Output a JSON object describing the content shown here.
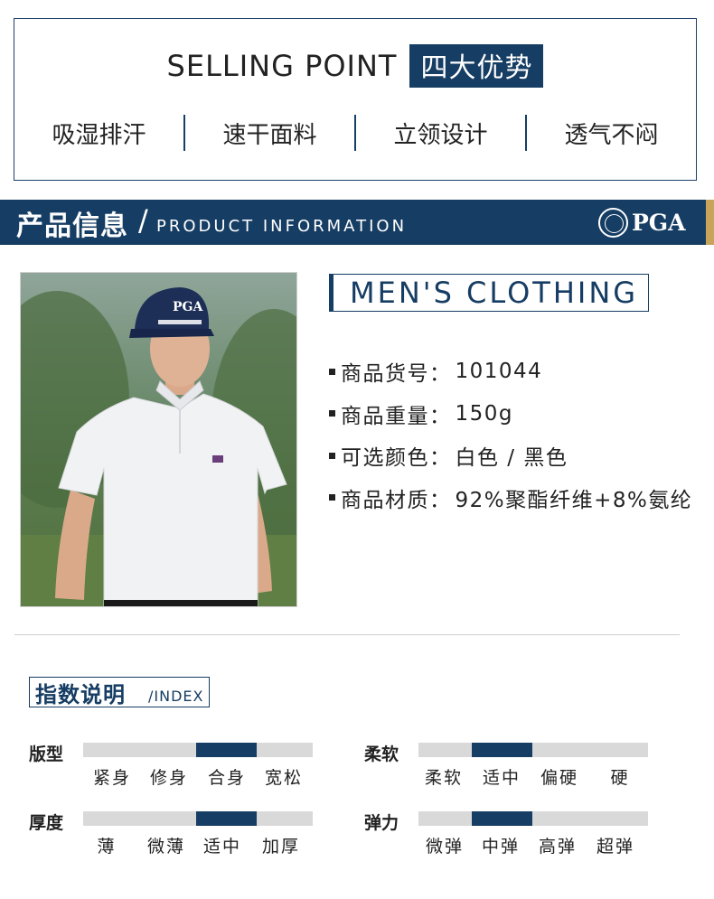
{
  "selling_point": {
    "title_en": "SELLING POINT",
    "title_cn": "四大优势",
    "items": [
      "吸湿排汗",
      "速干面料",
      "立领设计",
      "透气不闷"
    ]
  },
  "banner": {
    "title_cn": "产品信息",
    "slash": "/",
    "title_en": "PRODUCT INFORMATION",
    "logo_text": "PGA",
    "gold_color": "#c8a45a",
    "navy_color": "#163d63"
  },
  "product": {
    "photo_alt": "man in white polo shirt and navy PGA cap",
    "cap_text": "PGA",
    "heading": "MEN'S CLOTHING",
    "info": [
      {
        "label": "商品货号：",
        "value": "101044"
      },
      {
        "label": "商品重量：",
        "value": "150g"
      },
      {
        "label": "可选颜色：",
        "value": "白色 / 黑色"
      },
      {
        "label": "商品材质：",
        "value": "92%聚酯纤维+8%氨纶"
      }
    ]
  },
  "index": {
    "title_cn": "指数说明",
    "title_en": "/INDEX",
    "scales": [
      {
        "label": "版型",
        "options": [
          "紧身",
          "修身",
          "合身",
          "宽松"
        ],
        "selected_index": 2
      },
      {
        "label": "柔软",
        "options": [
          "柔软",
          "适中",
          "偏硬",
          "硬"
        ],
        "selected_index": 1
      },
      {
        "label": "厚度",
        "options": [
          "薄",
          "微薄",
          "适中",
          "加厚"
        ],
        "selected_index": 2
      },
      {
        "label": "弹力",
        "options": [
          "微弹",
          "中弹",
          "高弹",
          "超弹"
        ],
        "selected_index": 1
      }
    ]
  }
}
